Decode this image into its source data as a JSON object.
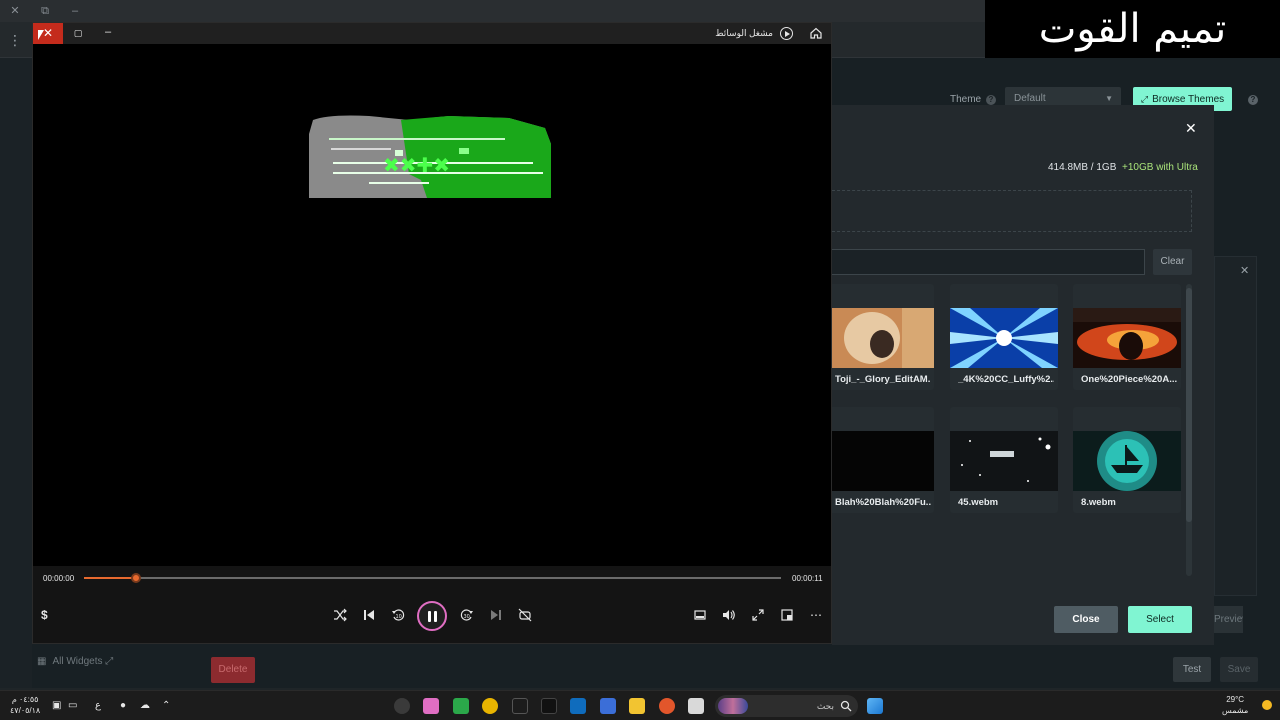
{
  "background_app": {
    "banner_text": "تميم القوت",
    "theme_label": "Theme",
    "theme_value": "Default",
    "browse_themes_label": "Browse Themes",
    "all_widgets_label": "All Widgets",
    "delete_label": "Delete",
    "test_label": "Test",
    "save_label": "Save"
  },
  "media_library": {
    "storage_text": "414.8MB / 1GB",
    "upsell_text": "+10GB with Ultra",
    "clear_label": "Clear",
    "close_label": "Close",
    "select_label": "Select",
    "preview_label": "Preview",
    "tiles": [
      {
        "name": "Toji_-_Glory_EditAM..."
      },
      {
        "name": "_4K%20CC_Luffy%2..."
      },
      {
        "name": "One%20Piece%20A..."
      },
      {
        "name": "Blah%20Blah%20Fu..."
      },
      {
        "name": "45.webm"
      },
      {
        "name": "8.webm"
      }
    ]
  },
  "player": {
    "title": "مشغل الوسائط",
    "time_current": "00:00:00",
    "time_duration": "00:00:11",
    "progress": 0.075,
    "left_symbol": "$"
  },
  "taskbar": {
    "clock_time": "٠٤:٥٥ م",
    "clock_date": "٤٧/٠٥/١٨",
    "lang": "ع",
    "search_label": "بحث",
    "weather_temp": "29°C",
    "weather_desc": "مشمس"
  },
  "colors": {
    "accent": "#80f5d2",
    "seek": "#e86a2f",
    "close_red": "#c42b1c",
    "delete_red": "#8c2b2f"
  }
}
